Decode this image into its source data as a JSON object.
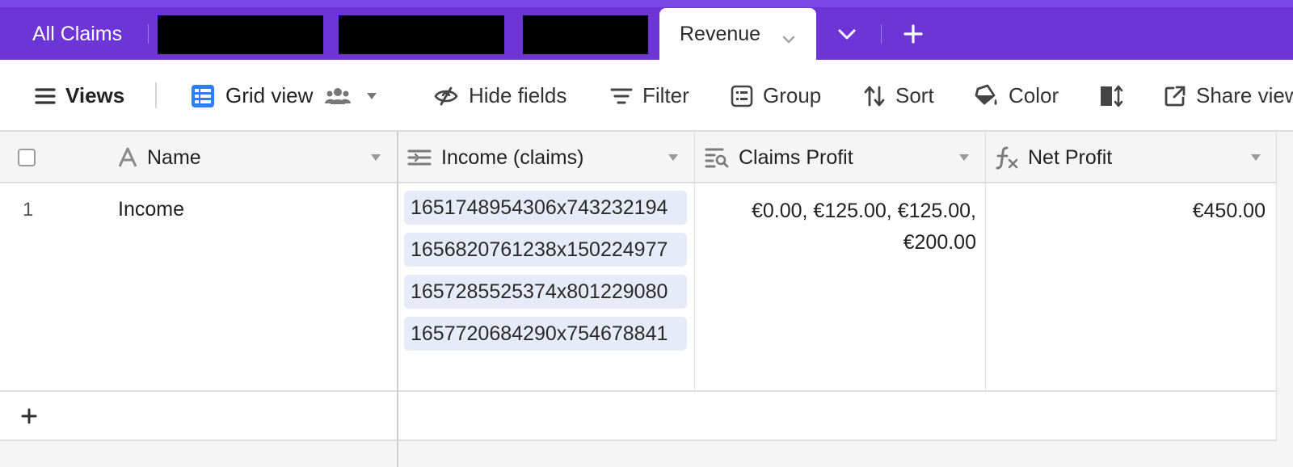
{
  "tabs": {
    "all_claims": "All Claims",
    "active": "Revenue"
  },
  "toolbar": {
    "views": "Views",
    "grid_view": "Grid view",
    "hide_fields": "Hide fields",
    "filter": "Filter",
    "group": "Group",
    "sort": "Sort",
    "color": "Color",
    "share_view": "Share view"
  },
  "columns": {
    "name": "Name",
    "income_claims": "Income (claims)",
    "claims_profit": "Claims Profit",
    "net_profit": "Net Profit"
  },
  "rows": [
    {
      "number": "1",
      "name": "Income",
      "income_claims": [
        "1651748954306x743232194",
        "1656820761238x150224977",
        "1657285525374x801229080",
        "1657720684290x754678841"
      ],
      "claims_profit_line1": "€0.00, €125.00, €125.00,",
      "claims_profit_line2": "€200.00",
      "net_profit": "€450.00"
    }
  ],
  "colors": {
    "tabbar": "#6d34d6",
    "grid_icon": "#2d7ff9",
    "chip_bg": "#e7ebf8"
  },
  "icons": {
    "views": "hamburger-icon",
    "grid_view": "grid-icon",
    "collaborators": "people-icon",
    "hide_fields": "eye-slash-icon",
    "filter": "filter-icon",
    "group": "group-icon",
    "sort": "sort-icon",
    "color": "paint-bucket-icon",
    "row_height": "row-height-icon",
    "share": "share-icon"
  }
}
